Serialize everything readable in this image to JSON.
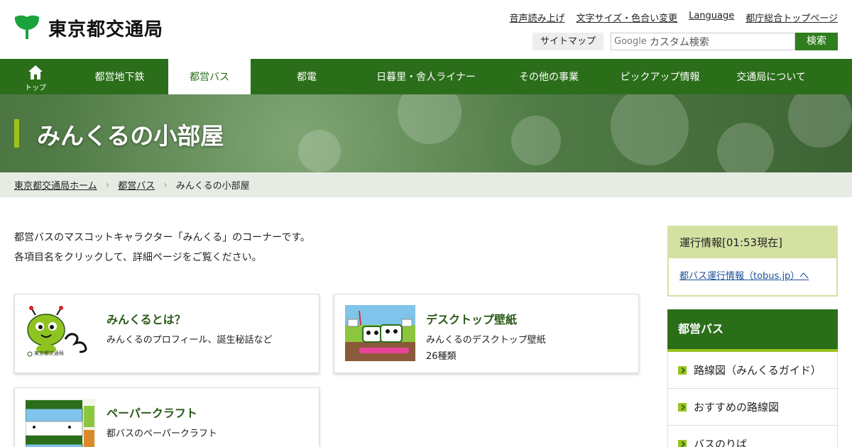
{
  "header": {
    "logo_text": "東京都交通局",
    "util_links": [
      "音声読み上げ",
      "文字サイズ・色合い変更",
      "Language",
      "都庁総合トップページ"
    ],
    "sitemap_label": "サイトマップ",
    "search_google": "Google",
    "search_placeholder": "カスタム検索",
    "search_button": "検索"
  },
  "nav": {
    "home_label": "トップ",
    "items": [
      "都営地下鉄",
      "都営バス",
      "都電",
      "日暮里・舎人ライナー",
      "その他の事業",
      "ピックアップ情報",
      "交通局について"
    ],
    "active": "都営バス"
  },
  "hero": {
    "title": "みんくるの小部屋"
  },
  "breadcrumb": [
    "東京都交通局ホーム",
    "都営バス",
    "みんくるの小部屋"
  ],
  "intro": {
    "line1": "都営バスのマスコットキャラクター「みんくる」のコーナーです。",
    "line2": "各項目名をクリックして、詳細ページをご覧ください。"
  },
  "cards": [
    {
      "title": "みんくるとは？",
      "desc": "みんくるのプロフィール、誕生秘話など",
      "desc2": "",
      "thumb_logo": "みんくる",
      "thumb_caption": "東京都交通局"
    },
    {
      "title": "デスクトップ壁紙",
      "desc": "みんくるのデスクトップ壁紙",
      "desc2": "26種類"
    },
    {
      "title": "ペーパークラフト",
      "desc": "都バスのペーパークラフト",
      "desc2": ""
    }
  ],
  "sidebar": {
    "info_title": "運行情報[01:53現在]",
    "info_link": "都バス運行情報（tobus.jp）へ",
    "menu_title": "都営バス",
    "menu_items": [
      "路線図（みんくるガイド）",
      "おすすめの路線図",
      "バスのりば"
    ]
  },
  "colors": {
    "brand_green": "#2b6e1a",
    "accent_lime": "#9bc31c",
    "logo_green": "#1aa23c"
  }
}
